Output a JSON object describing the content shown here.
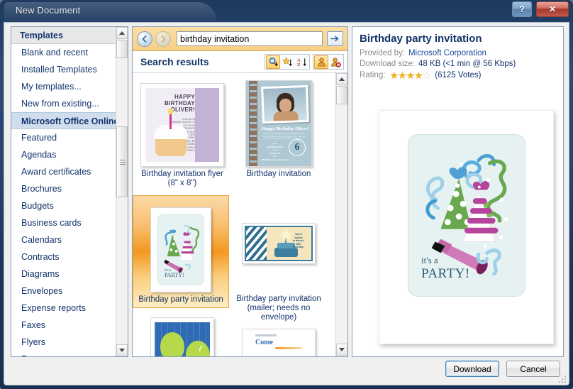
{
  "window": {
    "title": "New Document",
    "help_label": "?",
    "close_label": "✕"
  },
  "categories": {
    "header": "Templates",
    "items": [
      {
        "label": "Blank and recent",
        "selected": false
      },
      {
        "label": "Installed Templates",
        "selected": false
      },
      {
        "label": "My templates...",
        "selected": false
      },
      {
        "label": "New from existing...",
        "selected": false
      },
      {
        "label": "Microsoft Office Online",
        "selected": true
      },
      {
        "label": "Featured",
        "selected": false
      },
      {
        "label": "Agendas",
        "selected": false
      },
      {
        "label": "Award certificates",
        "selected": false
      },
      {
        "label": "Brochures",
        "selected": false
      },
      {
        "label": "Budgets",
        "selected": false
      },
      {
        "label": "Business cards",
        "selected": false
      },
      {
        "label": "Calendars",
        "selected": false
      },
      {
        "label": "Contracts",
        "selected": false
      },
      {
        "label": "Diagrams",
        "selected": false
      },
      {
        "label": "Envelopes",
        "selected": false
      },
      {
        "label": "Expense reports",
        "selected": false
      },
      {
        "label": "Faxes",
        "selected": false
      },
      {
        "label": "Flyers",
        "selected": false
      },
      {
        "label": "Forms",
        "selected": false
      }
    ]
  },
  "search": {
    "value": "birthday invitation",
    "placeholder": "",
    "back_icon": "back-arrow-icon",
    "forward_icon": "forward-arrow-icon",
    "go_icon": "start-search-arrow-icon"
  },
  "results": {
    "title": "Search results",
    "toolbar": [
      {
        "name": "sort-by-relevance-icon",
        "glyph": "magnifier-sort",
        "active": true
      },
      {
        "name": "sort-by-rating-icon",
        "glyph": "star-sort",
        "active": false
      },
      {
        "name": "sort-alphabetically-icon",
        "glyph": "az-sort",
        "active": false
      },
      {
        "name": "show-customer-submitted-icon",
        "glyph": "person",
        "active": true
      },
      {
        "name": "hide-customer-submitted-icon",
        "glyph": "person-block",
        "active": false
      }
    ],
    "tiles": [
      {
        "label": "Birthday invitation flyer (8\" x 8\")",
        "selected": false,
        "art": "cupcake-flyer"
      },
      {
        "label": "Birthday invitation",
        "selected": false,
        "art": "photo-card"
      },
      {
        "label": "Birthday party invitation",
        "selected": true,
        "art": "party-hats"
      },
      {
        "label": "Birthday party invitation (mailer; needs no envelope)",
        "selected": false,
        "art": "cake-mailer"
      },
      {
        "label": "",
        "selected": false,
        "art": "balloons"
      },
      {
        "label": "",
        "selected": false,
        "art": "come-card"
      }
    ]
  },
  "preview": {
    "title": "Birthday party invitation",
    "provided_by_label": "Provided by:",
    "provided_by_value": "Microsoft Corporation",
    "download_size_label": "Download size:",
    "download_size_value": "48 KB (<1 min @ 56 Kbps)",
    "rating_label": "Rating:",
    "rating_filled": 4,
    "rating_total": 5,
    "votes": "(6125 Votes)",
    "card_line1": "it's a",
    "card_line2": "PARTY!"
  },
  "footer": {
    "download_label": "Download",
    "cancel_label": "Cancel"
  },
  "colors": {
    "accent_blue": "#12346b",
    "selection_orange": "#f3981f",
    "star_gold": "#f0b323",
    "search_bar": "#f6cf86"
  }
}
